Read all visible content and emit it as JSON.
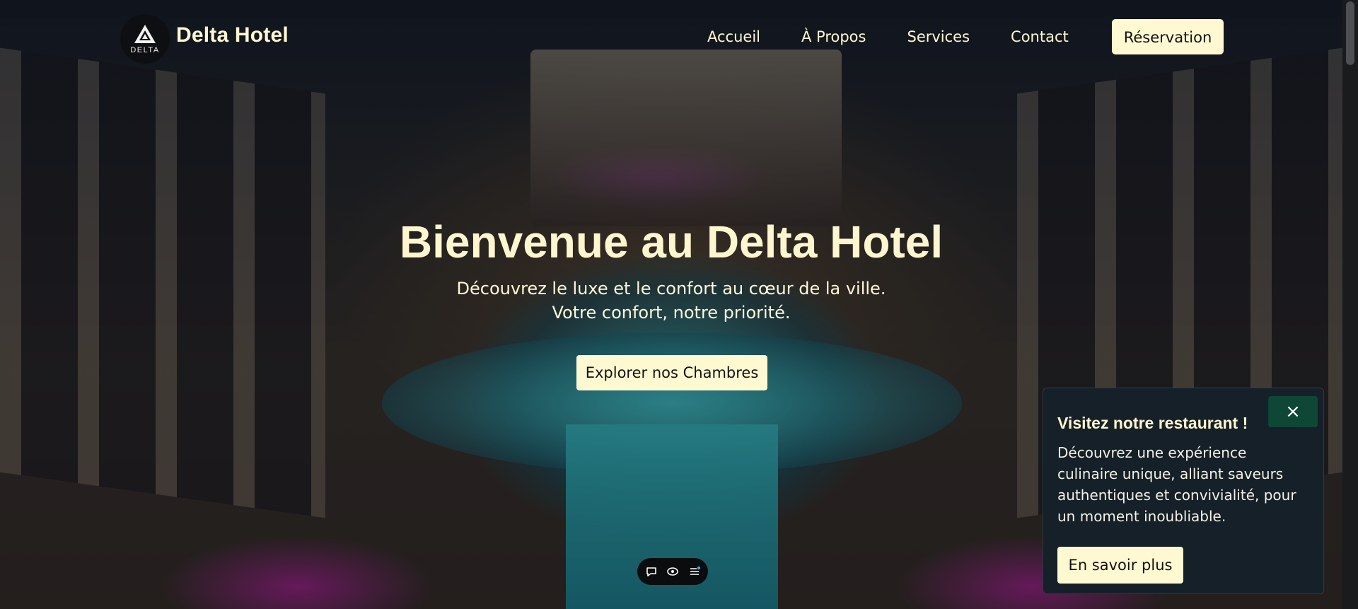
{
  "brand": {
    "logo_word": "DELTA",
    "name": "Delta Hotel"
  },
  "nav": {
    "items": [
      "Accueil",
      "À Propos",
      "Services",
      "Contact"
    ],
    "cta_label": "Réservation"
  },
  "hero": {
    "title": "Bienvenue au Delta Hotel",
    "subtitle_line1": "Découvrez le luxe et le confort au cœur de la ville.",
    "subtitle_line2": "Votre confort, notre priorité.",
    "cta_label": "Explorer nos Chambres"
  },
  "mini_toolbar": {
    "icons": [
      "chat-icon",
      "eye-icon",
      "list-icon"
    ]
  },
  "popup": {
    "close_label": "×",
    "title": "Visitez notre restaurant !",
    "text": "Découvrez une expérience culinaire unique, alliant saveurs authentiques et convivialité, pour un moment inoubliable.",
    "button_label": "En savoir plus"
  },
  "colors": {
    "accent_cream": "#fff9d2",
    "popup_bg": "#152028",
    "close_green": "#0e4736"
  }
}
